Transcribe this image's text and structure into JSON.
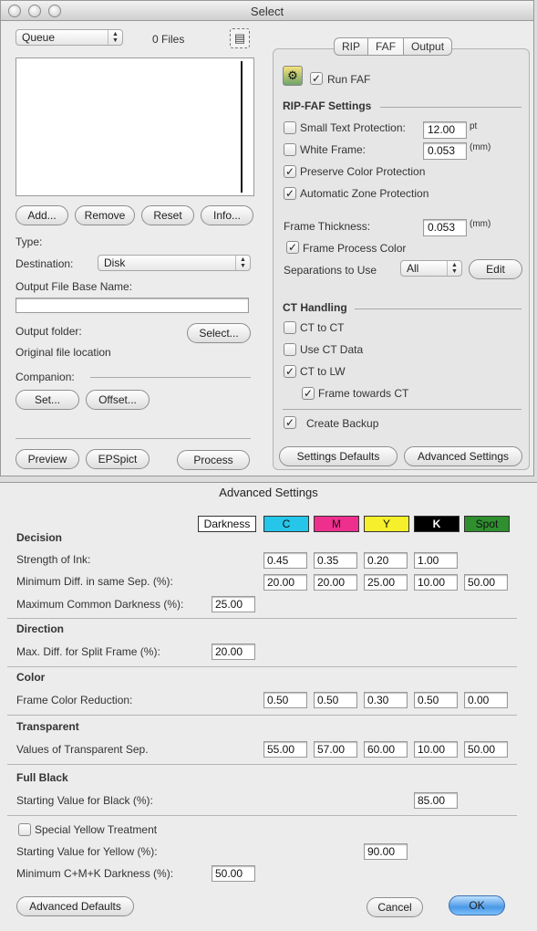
{
  "window": {
    "title": "Select",
    "controls": [
      "close",
      "minimize",
      "zoom"
    ]
  },
  "left": {
    "queue_select": "Queue",
    "file_count": "0 Files",
    "buttons": {
      "add": "Add...",
      "remove": "Remove",
      "reset": "Reset",
      "info": "Info..."
    },
    "type_label": "Type:",
    "destination_label": "Destination:",
    "destination_value": "Disk",
    "output_base_label": "Output File Base Name:",
    "output_base_value": "",
    "output_folder_label": "Output folder:",
    "select_button": "Select...",
    "original_location": "Original file location",
    "companion_label": "Companion:",
    "set_button": "Set...",
    "offset_button": "Offset...",
    "preview_button": "Preview",
    "epspict_button": "EPSpict",
    "process_button": "Process"
  },
  "tabs": [
    "RIP",
    "FAF",
    "Output"
  ],
  "active_tab": "FAF",
  "faf": {
    "run_faf": {
      "label": "Run FAF",
      "checked": true
    },
    "settings_header": "RIP-FAF Settings",
    "small_text": {
      "label": "Small Text Protection:",
      "checked": false,
      "value": "12.00",
      "unit": "pt"
    },
    "white_frame": {
      "label": "White Frame:",
      "checked": false,
      "value": "0.053",
      "unit": "(mm)"
    },
    "preserve_color": {
      "label": "Preserve Color Protection",
      "checked": true
    },
    "auto_zone": {
      "label": "Automatic Zone Protection",
      "checked": true
    },
    "frame_thickness": {
      "label": "Frame  Thickness:",
      "value": "0.053",
      "unit": "(mm)"
    },
    "frame_process_color": {
      "label": "Frame Process Color",
      "checked": true
    },
    "separations": {
      "label": "Separations to Use",
      "value": "All",
      "edit": "Edit"
    },
    "ct_header": "CT Handling",
    "ct_to_ct": {
      "label": "CT to CT",
      "checked": false
    },
    "use_ct_data": {
      "label": "Use CT Data",
      "checked": false
    },
    "ct_to_lw": {
      "label": "CT to LW",
      "checked": true
    },
    "frame_towards_ct": {
      "label": "Frame towards CT",
      "checked": true
    },
    "create_backup": {
      "label": "Create Backup",
      "checked": true
    },
    "settings_defaults": "Settings Defaults",
    "advanced_settings": "Advanced Settings"
  },
  "advanced": {
    "title": "Advanced Settings",
    "columns": [
      {
        "label": "Darkness",
        "bg": "#ffffff",
        "fg": "#111111"
      },
      {
        "label": "C",
        "bg": "#26c6ea",
        "fg": "#111111"
      },
      {
        "label": "M",
        "bg": "#ee2f8e",
        "fg": "#111111"
      },
      {
        "label": "Y",
        "bg": "#f6f02c",
        "fg": "#111111"
      },
      {
        "label": "K",
        "bg": "#000000",
        "fg": "#ffffff"
      },
      {
        "label": "Spot",
        "bg": "#2f8f2f",
        "fg": "#111111"
      }
    ],
    "decision": {
      "header": "Decision",
      "strength_label": "Strength of Ink:",
      "strength": [
        "0.45",
        "0.35",
        "0.20",
        "1.00"
      ],
      "min_diff_label": "Minimum Diff. in same Sep. (%):",
      "min_diff": [
        "20.00",
        "20.00",
        "25.00",
        "10.00",
        "50.00"
      ],
      "max_common_label": "Maximum Common Darkness (%):",
      "max_common": "25.00"
    },
    "direction": {
      "header": "Direction",
      "max_diff_label": "Max. Diff. for Split Frame (%):",
      "max_diff": "20.00"
    },
    "color": {
      "header": "Color",
      "reduction_label": "Frame Color Reduction:",
      "reduction": [
        "0.50",
        "0.50",
        "0.30",
        "0.50",
        "0.00"
      ]
    },
    "transparent": {
      "header": "Transparent",
      "values_label": "Values of Transparent Sep.",
      "values": [
        "55.00",
        "57.00",
        "60.00",
        "10.00",
        "50.00"
      ]
    },
    "full_black": {
      "header": "Full Black",
      "start_label": "Starting Value for Black (%):",
      "start": "85.00"
    },
    "yellow": {
      "special_label": "Special Yellow Treatment",
      "special_checked": false,
      "start_label": "Starting Value for Yellow (%):",
      "start": "90.00",
      "min_cmk_label": "Minimum C+M+K Darkness (%):",
      "min_cmk": "50.00"
    },
    "buttons": {
      "defaults": "Advanced Defaults",
      "cancel": "Cancel",
      "ok": "OK"
    }
  }
}
